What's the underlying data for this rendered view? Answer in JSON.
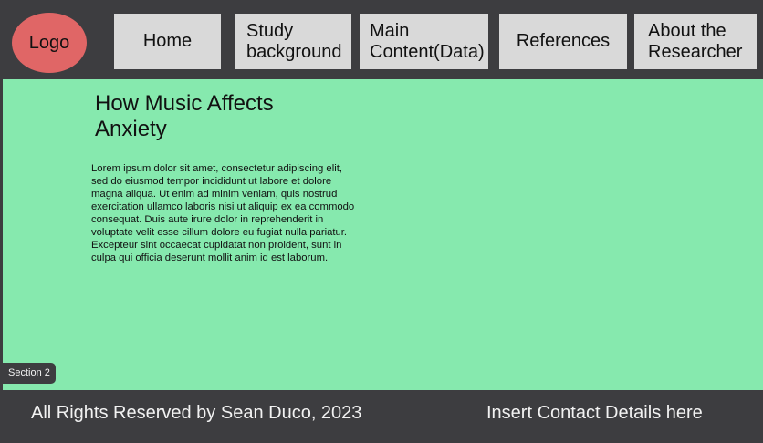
{
  "nav": {
    "logo": "Logo",
    "items": [
      {
        "label": "Home"
      },
      {
        "label": "Study\nbackground"
      },
      {
        "label": "Main\nContent(Data)"
      },
      {
        "label": "References"
      },
      {
        "label": "About the\nResearcher"
      }
    ]
  },
  "main": {
    "title": "How Music Affects Anxiety",
    "body": "Lorem ipsum dolor sit amet, consectetur adipiscing elit, sed do eiusmod tempor incididunt ut labore et dolore magna aliqua. Ut enim ad minim veniam, quis nostrud exercitation ullamco laboris nisi ut aliquip ex ea commodo consequat. Duis aute irure dolor in reprehenderit in voluptate velit esse cillum dolore eu fugiat nulla pariatur. Excepteur sint occaecat cupidatat non proident, sunt in culpa qui officia deserunt mollit anim id est laborum.",
    "section_tag": "Section 2"
  },
  "footer": {
    "rights": "All Rights Reserved by Sean Duco, 2023",
    "contact": "Insert Contact Details here"
  },
  "colors": {
    "background": "#3d3d40",
    "main_bg": "#86e9ae",
    "logo_bg": "#e06666",
    "nav_button_bg": "#d9d9d9",
    "footer_text": "#f2f2f2"
  }
}
